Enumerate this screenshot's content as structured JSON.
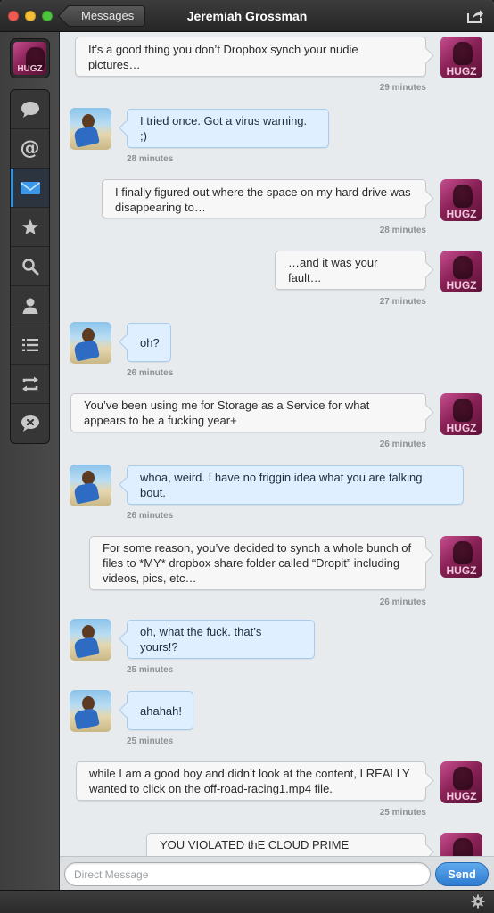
{
  "window": {
    "title": "Jeremiah Grossman",
    "back_label": "Messages"
  },
  "sidebar": {
    "self_avatar_text": "HUGZ",
    "items": [
      {
        "name": "mentions-timeline",
        "icon": "speech-bubble-icon",
        "active": false
      },
      {
        "name": "mentions",
        "icon": "at-sign-icon",
        "active": false
      },
      {
        "name": "messages",
        "icon": "envelope-icon",
        "active": true
      },
      {
        "name": "favorites",
        "icon": "star-icon",
        "active": false
      },
      {
        "name": "search",
        "icon": "search-icon",
        "active": false
      },
      {
        "name": "profile",
        "icon": "person-icon",
        "active": false
      },
      {
        "name": "lists",
        "icon": "list-icon",
        "active": false
      },
      {
        "name": "retweets",
        "icon": "retweet-icon",
        "active": false
      },
      {
        "name": "muted",
        "icon": "mute-bubble-icon",
        "active": false
      }
    ]
  },
  "messages": [
    {
      "dir": "out",
      "text": "It’s a good thing you don’t Dropbox synch your nudie pictures…",
      "time": "29 minutes"
    },
    {
      "dir": "in",
      "text": "I tried once. Got a virus warning. ;)",
      "time": "28 minutes"
    },
    {
      "dir": "out",
      "text": "I finally figured out where the space on my hard drive was disappearing to…",
      "time": "28 minutes"
    },
    {
      "dir": "out",
      "text": "…and it was your fault…",
      "time": "27 minutes"
    },
    {
      "dir": "in",
      "text": "oh?",
      "time": "26 minutes"
    },
    {
      "dir": "out",
      "text": "You’ve been using me for Storage as a Service for what appears to be a fucking year+",
      "time": "26 minutes"
    },
    {
      "dir": "in",
      "text": "whoa, weird. I have no friggin idea what you are talking bout.",
      "time": "26 minutes"
    },
    {
      "dir": "out",
      "text": "For some reason, you’ve decided to synch a whole bunch of files to *MY* dropbox share folder called “Dropit” including videos, pics, etc…",
      "time": "26 minutes"
    },
    {
      "dir": "in",
      "text": "oh, what the fuck. that’s yours!?",
      "time": "25 minutes"
    },
    {
      "dir": "in",
      "text": "ahahah!",
      "time": "25 minutes"
    },
    {
      "dir": "out",
      "text": "while I am a good boy and didn’t look at the content, I REALLY wanted to click on the off-road-racing1.mp4 file.",
      "time": "25 minutes"
    },
    {
      "dir": "out",
      "text": "YOU VIOLATED thE CLOUD PRIME DIRECTIVE",
      "time": ""
    }
  ],
  "composer": {
    "placeholder": "Direct Message",
    "value": "",
    "send_label": "Send"
  },
  "colors": {
    "accent": "#2f8fe0",
    "incoming_bubble": "#dfefff",
    "outgoing_bubble": "#f7f7f7",
    "hugz_avatar": "#8a2257"
  }
}
